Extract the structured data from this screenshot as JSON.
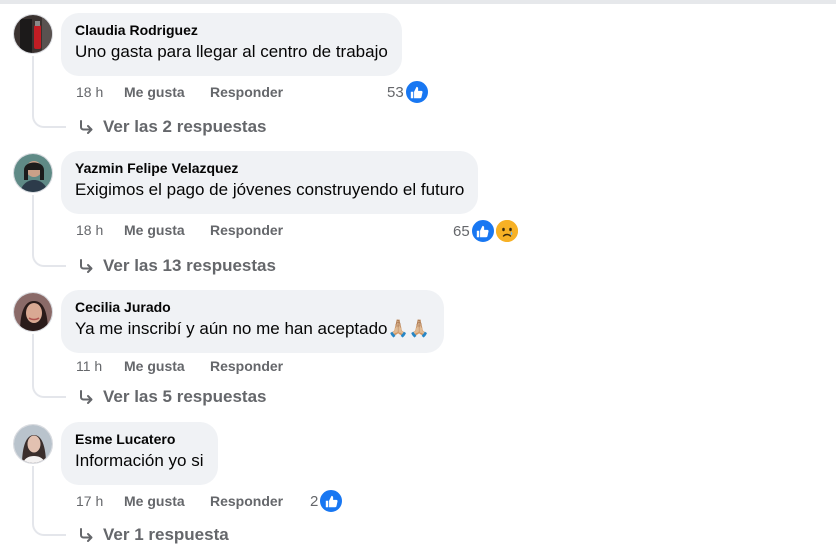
{
  "comments": [
    {
      "author": "Claudia Rodriguez",
      "text": "Uno gasta para llegar al centro de trabajo",
      "time": "18 h",
      "like_label": "Me gusta",
      "reply_label": "Responder",
      "reaction_count": "53",
      "reactions": [
        "like-icon"
      ],
      "replies_label": "Ver las 2 respuestas"
    },
    {
      "author": "Yazmin Felipe Velazquez",
      "text": "Exigimos el pago de jóvenes construyendo el futuro",
      "time": "18 h",
      "like_label": "Me gusta",
      "reply_label": "Responder",
      "reaction_count": "65",
      "reactions": [
        "like-icon",
        "sad-face-icon"
      ],
      "replies_label": "Ver las 13 respuestas"
    },
    {
      "author": "Cecilia Jurado",
      "text": "Ya me inscribí y aún no me han aceptado🙏🏼🙏🏼",
      "time": "11 h",
      "like_label": "Me gusta",
      "reply_label": "Responder",
      "replies_label": "Ver las 5 respuestas"
    },
    {
      "author": "Esme Lucatero",
      "text": "Información yo si",
      "time": "17 h",
      "like_label": "Me gusta",
      "reply_label": "Responder",
      "reaction_count": "2",
      "reactions": [
        "like-icon"
      ],
      "replies_label": "Ver 1 respuesta"
    }
  ],
  "colors": {
    "bubble": "#f0f2f5",
    "meta_text": "#65676b",
    "like_blue": "#1877f2",
    "sad_yellow": "#f7b125"
  }
}
